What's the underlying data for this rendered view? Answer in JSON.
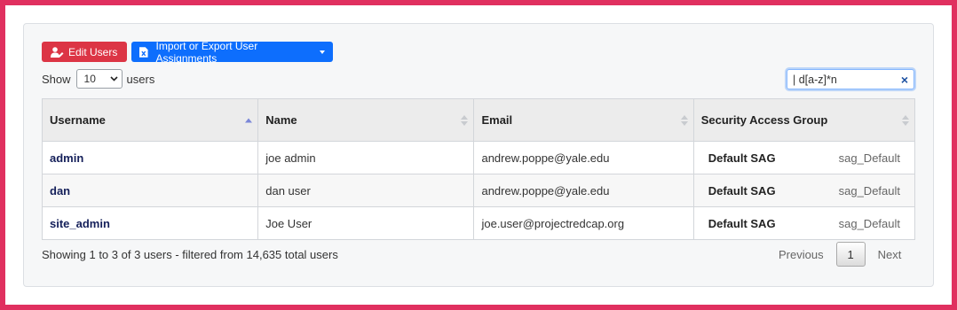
{
  "toolbar": {
    "edit_users_label": "Edit Users",
    "import_export_label": "Import or Export User Assignments"
  },
  "length_control": {
    "prefix": "Show",
    "selected": "10",
    "suffix": "users"
  },
  "search": {
    "value": "| d[a-z]*n",
    "clear_glyph": "×"
  },
  "table": {
    "columns": [
      "Username",
      "Name",
      "Email",
      "Security Access Group"
    ],
    "rows": [
      {
        "username": "admin",
        "name": "joe admin",
        "email": "andrew.poppe@yale.edu",
        "sag_name": "Default SAG",
        "sag_id": "sag_Default"
      },
      {
        "username": "dan",
        "name": "dan user",
        "email": "andrew.poppe@yale.edu",
        "sag_name": "Default SAG",
        "sag_id": "sag_Default"
      },
      {
        "username": "site_admin",
        "name": "Joe User",
        "email": "joe.user@projectredcap.org",
        "sag_name": "Default SAG",
        "sag_id": "sag_Default"
      }
    ]
  },
  "info_text": "Showing 1 to 3 of 3 users - filtered from 14,635 total users",
  "pagination": {
    "previous": "Previous",
    "current_page": "1",
    "next": "Next"
  },
  "colors": {
    "frame": "#e0305f",
    "danger": "#dc3545",
    "primary": "#0d6efd"
  }
}
